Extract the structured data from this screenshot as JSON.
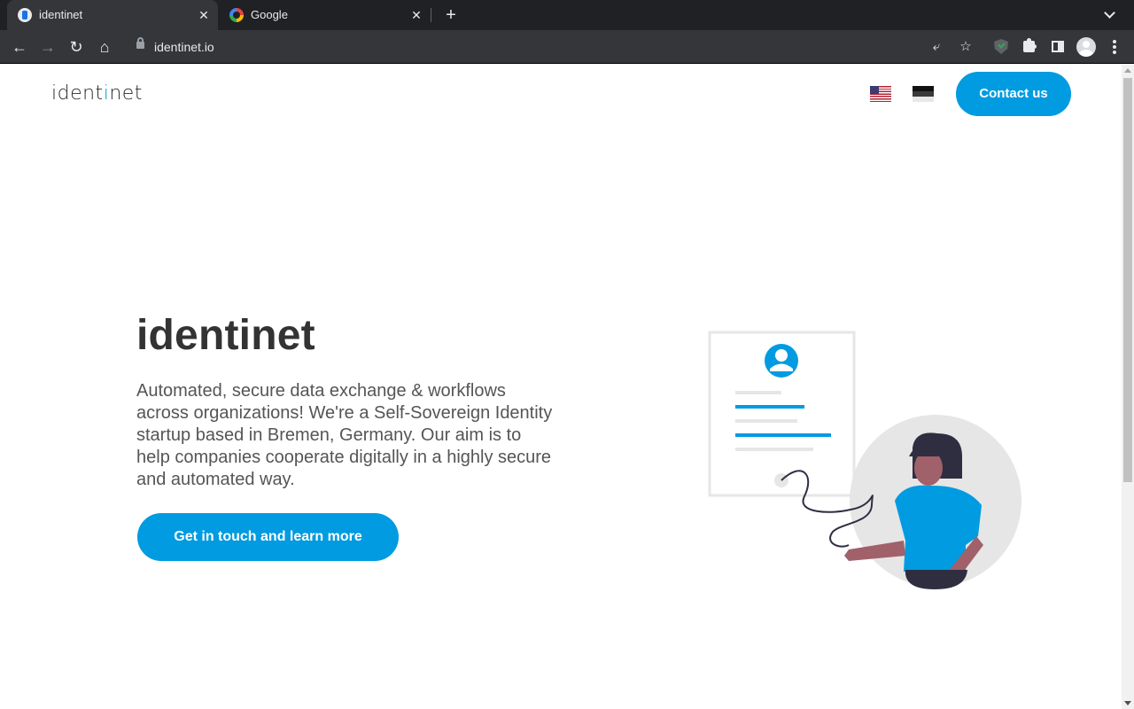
{
  "browser": {
    "tabs": [
      {
        "title": "identinet",
        "active": true
      },
      {
        "title": "Google",
        "active": false
      }
    ],
    "url": "identinet.io"
  },
  "site": {
    "logo_prefix": "ident",
    "logo_accent": "i",
    "logo_suffix": "net",
    "languages": [
      "English (US flag)",
      "Estonian flag"
    ],
    "contact_label": "Contact us",
    "hero_title": "identinet",
    "hero_description": "Automated, secure data exchange & workflows across organizations! We're a Self-Sovereign Identity startup based in Bremen, Germany. Our aim is to help companies cooperate digitally in a highly secure and automated way.",
    "cta_label": "Get in touch and learn more"
  },
  "colors": {
    "accent": "#009be0",
    "text_dark": "#333333",
    "text_body": "#555555",
    "chrome_dark": "#202124",
    "chrome_toolbar": "#35363a"
  },
  "icons": {
    "back": "arrow-left-icon",
    "forward": "arrow-right-icon",
    "reload": "reload-icon",
    "home": "home-icon",
    "share": "share-icon",
    "bookmark": "star-icon",
    "extension": "puzzle-icon"
  }
}
